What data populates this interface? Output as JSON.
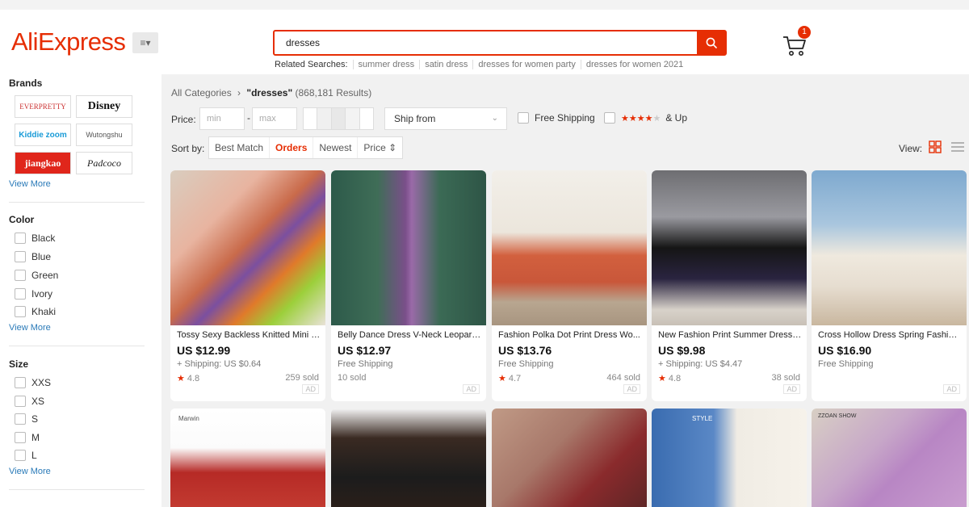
{
  "header": {
    "logo": "AliExpress",
    "search_value": "dresses",
    "related_label": "Related Searches:",
    "related": [
      "summer dress",
      "satin dress",
      "dresses for women party",
      "dresses for women 2021"
    ],
    "cart_count": "1"
  },
  "sidebar": {
    "brands_title": "Brands",
    "brands": [
      "EVERPRETTY",
      "Disney",
      "Kiddie zoom",
      "Wutongshu",
      "jiangkao",
      "Padcoco"
    ],
    "brands_more": "View More",
    "color_title": "Color",
    "colors": [
      "Black",
      "Blue",
      "Green",
      "Ivory",
      "Khaki"
    ],
    "color_more": "View More",
    "size_title": "Size",
    "sizes": [
      "XXS",
      "XS",
      "S",
      "M",
      "L"
    ],
    "size_more": "View More"
  },
  "filters": {
    "crumb_root": "All Categories",
    "crumb_sep": "›",
    "crumb_query": "\"dresses\"",
    "crumb_count": "(868,181 Results)",
    "price_label": "Price:",
    "min_placeholder": "min",
    "max_placeholder": "max",
    "ship_from": "Ship from",
    "free_shipping": "Free Shipping",
    "and_up": "& Up",
    "sort_label": "Sort by:",
    "sort_options": [
      "Best Match",
      "Orders",
      "Newest",
      "Price ⇕"
    ],
    "view_label": "View:",
    "accent": "#e62e04"
  },
  "products": [
    {
      "title": "Tossy Sexy Backless Knitted Mini P...",
      "price": "US $12.99",
      "shipping": "+ Shipping: US $0.64",
      "rating": "4.8",
      "sold": "259 sold",
      "ad": "AD"
    },
    {
      "title": "Belly Dance Dress V-Neck Leopard ...",
      "price": "US $12.97",
      "shipping": "Free Shipping",
      "rating": "",
      "sold": "10 sold",
      "ad": "AD"
    },
    {
      "title": "Fashion Polka Dot Print Dress Wo...",
      "price": "US $13.76",
      "shipping": "Free Shipping",
      "rating": "4.7",
      "sold": "464 sold",
      "ad": "AD"
    },
    {
      "title": "New Fashion Print Summer Dress ...",
      "price": "US $9.98",
      "shipping": "+ Shipping: US $4.47",
      "rating": "4.8",
      "sold": "38 sold",
      "ad": "AD"
    },
    {
      "title": "Cross Hollow Dress Spring Fashion...",
      "price": "US $16.90",
      "shipping": "Free Shipping",
      "rating": "",
      "sold": "",
      "ad": "AD"
    }
  ],
  "row2": [
    {
      "label": "Marwin"
    },
    {
      "label": ""
    },
    {
      "label": ""
    },
    {
      "label": "STYLE"
    },
    {
      "label": "ZZOAN SHOW"
    }
  ]
}
